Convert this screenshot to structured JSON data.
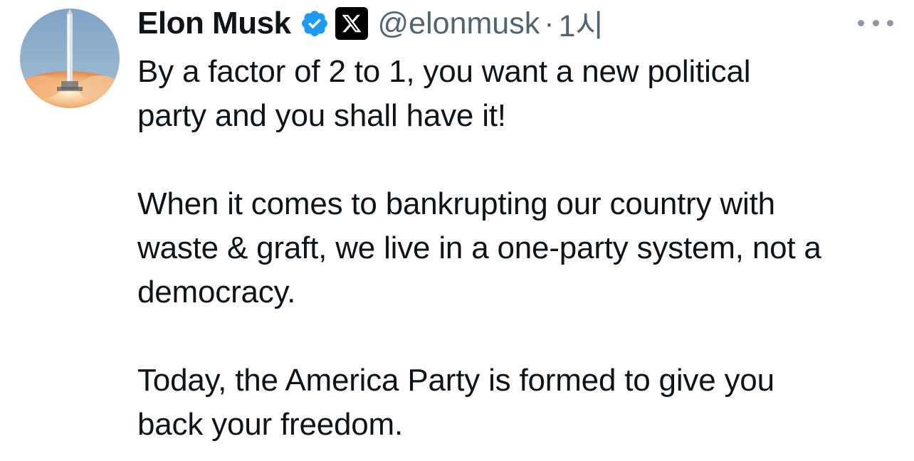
{
  "author": {
    "name": "Elon Musk",
    "handle": "@elonmusk",
    "separator": "·",
    "time": "1시",
    "verified_icon": "verified-badge-icon",
    "affiliate_icon": "x-logo-icon"
  },
  "tweet": {
    "lines": [
      "By a factor of 2 to 1, you want a new political",
      "party and you shall have it!",
      "When it comes to bankrupting our country with",
      "waste & graft, we live in a one-party system, not a",
      "democracy.",
      "Today, the America Party is formed to give you",
      "back your freedom."
    ]
  },
  "colors": {
    "text": "#0f1419",
    "secondary": "#536471",
    "verified": "#1d9bf0"
  }
}
